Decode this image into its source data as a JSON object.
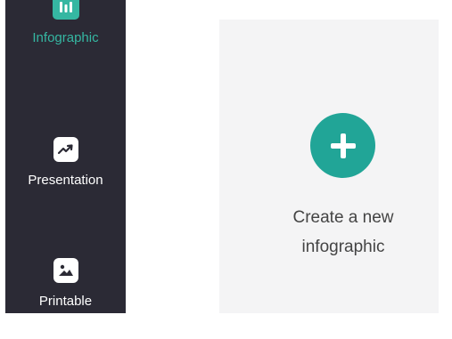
{
  "sidebar": {
    "items": [
      {
        "label": "Infographic",
        "icon": "bar-chart-icon",
        "active": true
      },
      {
        "label": "Presentation",
        "icon": "trending-up-icon",
        "active": false
      },
      {
        "label": "Printable",
        "icon": "image-icon",
        "active": false
      }
    ]
  },
  "create_card": {
    "line1": "Create a new",
    "line2": "infographic",
    "button_icon": "plus-icon"
  },
  "colors": {
    "sidebar_bg": "#2b2a35",
    "accent": "#35b7a2",
    "button": "#21a597",
    "card_bg": "#f4f4f5",
    "text": "#444444"
  }
}
